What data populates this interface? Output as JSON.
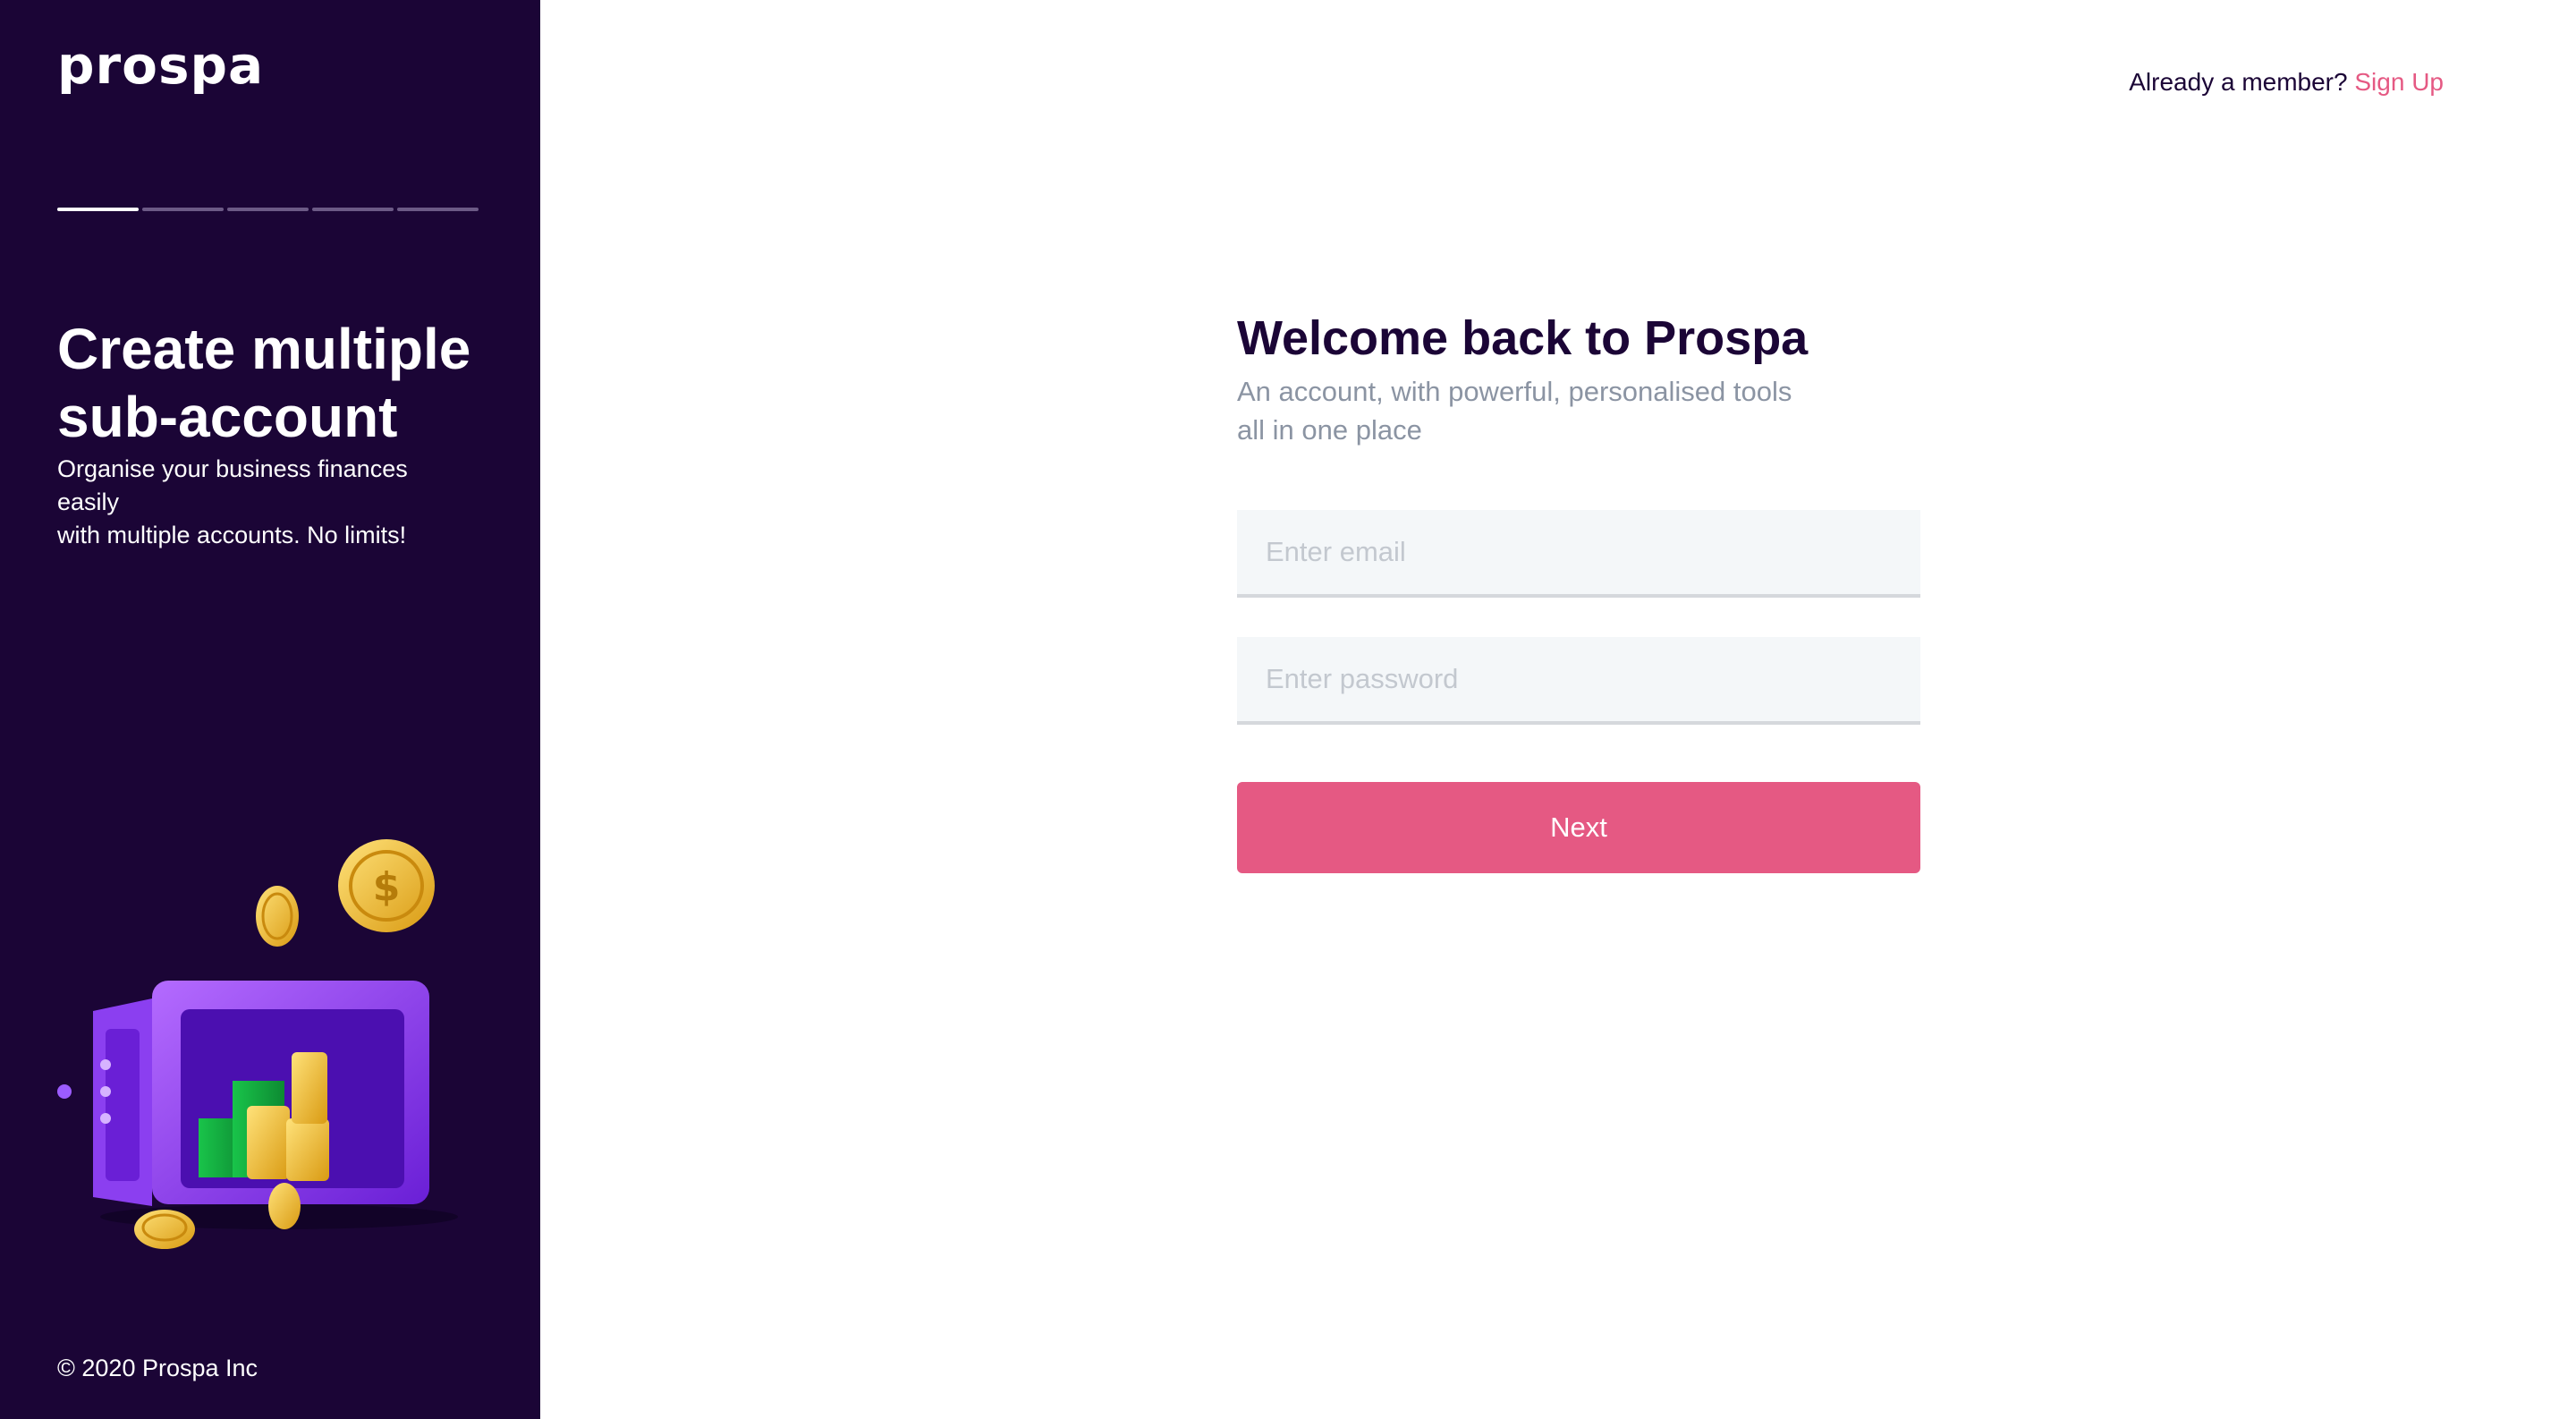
{
  "sidebar": {
    "logo": "prospa",
    "progress": {
      "total_steps": 5,
      "current_step": 1
    },
    "promo": {
      "title": "Create multiple sub-account",
      "description_line1": "Organise your business finances easily",
      "description_line2": "with multiple accounts. No limits!"
    },
    "copyright": "© 2020 Prospa Inc"
  },
  "header": {
    "prompt": "Already a member?",
    "signup_link": "Sign Up"
  },
  "form": {
    "title": "Welcome back to Prospa",
    "subtitle_line1": "An account, with powerful, personalised tools",
    "subtitle_line2": "all in one place",
    "email": {
      "value": "",
      "placeholder": "Enter email"
    },
    "password": {
      "value": "",
      "placeholder": "Enter password"
    },
    "next_label": "Next"
  },
  "colors": {
    "sidebar_bg": "#1b0536",
    "accent": "#e55983",
    "heading": "#1b0536",
    "muted": "#8b94a3",
    "input_bg": "#f4f7f9"
  }
}
